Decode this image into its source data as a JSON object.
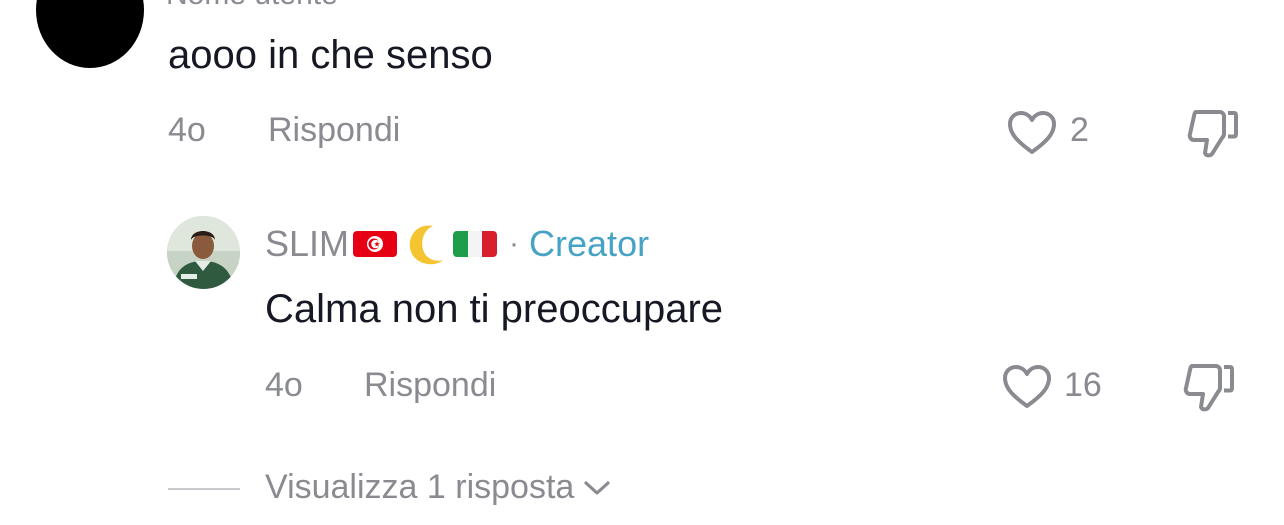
{
  "comment": {
    "username": "Nome utente",
    "text": "aooo in che senso",
    "time": "4o",
    "reply_label": "Rispondi",
    "like_count": "2"
  },
  "reply": {
    "username": "SLIM",
    "separator": "·",
    "creator_badge": "Creator",
    "text": "Calma non ti preoccupare",
    "time": "4o",
    "reply_label": "Rispondi",
    "like_count": "16"
  },
  "view_replies_label": "Visualizza 1 risposta",
  "icons": {
    "like": "heart-outline-icon",
    "dislike": "thumbs-down-icon",
    "expand": "chevron-down-icon"
  },
  "colors": {
    "text_primary": "#161823",
    "text_secondary": "#8a8b91",
    "creator_accent": "#47a3c6"
  }
}
